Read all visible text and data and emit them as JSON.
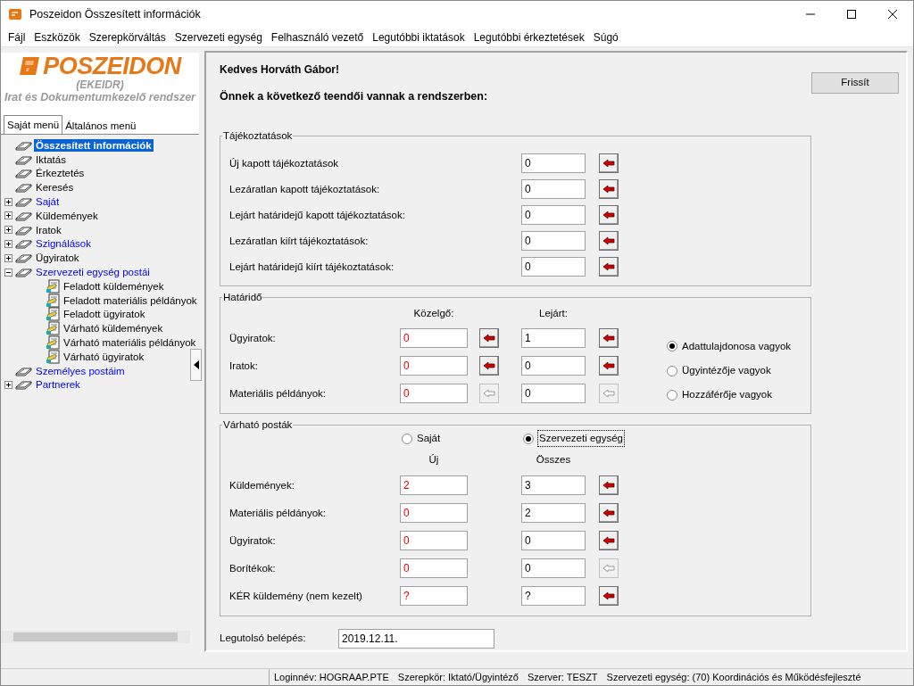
{
  "window": {
    "title": "Poszeidon Összesített információk"
  },
  "menu": [
    "Fájl",
    "Eszközök",
    "Szerepkörváltás",
    "Szervezeti egység",
    "Felhasználó vezető",
    "Legutóbbi iktatások",
    "Legutóbbi érkeztetések",
    "Súgó"
  ],
  "logo": {
    "name": "POSZEIDON",
    "subtitle": "(EKEIDR)",
    "tagline": "Irat és Dokumentumkezelő rendszer"
  },
  "sidebar_tabs": [
    {
      "label": "Saját menü",
      "selected": true
    },
    {
      "label": "Általános menü",
      "selected": false
    }
  ],
  "tree": [
    {
      "label": "Összesített információk",
      "kind": "book",
      "link": false,
      "selected": true
    },
    {
      "label": "Iktatás",
      "kind": "book",
      "link": false,
      "selected": false
    },
    {
      "label": "Érkeztetés",
      "kind": "book",
      "link": false,
      "selected": false
    },
    {
      "label": "Keresés",
      "kind": "book",
      "link": false,
      "selected": false
    },
    {
      "label": "Saját",
      "kind": "book",
      "link": true,
      "selected": false,
      "expanded": false
    },
    {
      "label": "Küldemények",
      "kind": "book",
      "link": false,
      "selected": false,
      "expanded": false
    },
    {
      "label": "Iratok",
      "kind": "book",
      "link": false,
      "selected": false,
      "expanded": false
    },
    {
      "label": "Szignálások",
      "kind": "book",
      "link": true,
      "selected": false,
      "expanded": false
    },
    {
      "label": "Ügyiratok",
      "kind": "book",
      "link": false,
      "selected": false,
      "expanded": false
    },
    {
      "label": "Szervezeti egység postái",
      "kind": "book",
      "link": true,
      "selected": false,
      "expanded": true,
      "children": [
        {
          "label": "Feladott küldemények",
          "kind": "mail",
          "link": false,
          "selected": false
        },
        {
          "label": "Feladott materiális példányok",
          "kind": "mail",
          "link": false,
          "selected": false
        },
        {
          "label": "Feladott ügyiratok",
          "kind": "mail",
          "link": false,
          "selected": false
        },
        {
          "label": "Várható küldemények",
          "kind": "mail",
          "link": false,
          "selected": false
        },
        {
          "label": "Várható materiális példányok",
          "kind": "mail",
          "link": false,
          "selected": false
        },
        {
          "label": "Várható ügyiratok",
          "kind": "mail",
          "link": false,
          "selected": false
        }
      ]
    },
    {
      "label": "Személyes postáim",
      "kind": "book",
      "link": true,
      "selected": false
    },
    {
      "label": "Partnerek",
      "kind": "book",
      "link": true,
      "selected": false,
      "expanded": false
    }
  ],
  "greeting": "Kedves Horváth Gábor!",
  "intro": "Önnek a következő teendői vannak a rendszerben:",
  "refresh_button": "Frissít",
  "notifications": {
    "title": "Tájékoztatások",
    "rows": [
      {
        "label": "Új kapott tájékoztatások",
        "value": "0",
        "disabled": false
      },
      {
        "label": "Lezáratlan kapott tájékoztatások:",
        "value": "0",
        "disabled": false
      },
      {
        "label": "Lejárt határidejű kapott tájékoztatások:",
        "value": "0",
        "disabled": false
      },
      {
        "label": "Lezáratlan kiírt tájékoztatások:",
        "value": "0",
        "disabled": false
      },
      {
        "label": "Lejárt határidejű kiírt tájékoztatások:",
        "value": "0",
        "disabled": false
      }
    ]
  },
  "deadline": {
    "title": "Határidő",
    "columns": [
      "Közelgő:",
      "Lejárt:"
    ],
    "rows": [
      {
        "label": "Ügyiratok:",
        "cells": [
          {
            "value": "0",
            "alert": true,
            "action": {
              "disabled": false
            }
          },
          {
            "value": "1",
            "alert": false,
            "action": {
              "disabled": false
            }
          }
        ]
      },
      {
        "label": "Iratok:",
        "cells": [
          {
            "value": "0",
            "alert": true,
            "action": {
              "disabled": false
            }
          },
          {
            "value": "0",
            "alert": false,
            "action": {
              "disabled": false
            }
          }
        ]
      },
      {
        "label": "Materiális példányok:",
        "cells": [
          {
            "value": "0",
            "alert": true,
            "action": {
              "disabled": true
            }
          },
          {
            "value": "0",
            "alert": false,
            "action": {
              "disabled": true
            }
          }
        ]
      }
    ],
    "options": [
      {
        "label": "Adattulajdonosa vagyok",
        "selected": true
      },
      {
        "label": "Ügyintézője vagyok",
        "selected": false
      },
      {
        "label": "Hozzáférője vagyok",
        "selected": false
      }
    ]
  },
  "expected_mail": {
    "title": "Várható posták",
    "scopes": [
      {
        "label": "Saját",
        "selected": false,
        "focused": false
      },
      {
        "label": "Szervezeti egység",
        "selected": true,
        "focused": true
      }
    ],
    "columns": [
      "Új",
      "Összes"
    ],
    "rows": [
      {
        "label": "Küldemények:",
        "cells": [
          {
            "value": "2",
            "alert": true
          },
          {
            "value": "3",
            "alert": false,
            "action": {
              "disabled": false
            }
          }
        ]
      },
      {
        "label": "Materiális példányok:",
        "cells": [
          {
            "value": "0",
            "alert": true
          },
          {
            "value": "2",
            "alert": false,
            "action": {
              "disabled": false
            }
          }
        ]
      },
      {
        "label": "Ügyiratok:",
        "cells": [
          {
            "value": "0",
            "alert": true
          },
          {
            "value": "0",
            "alert": false,
            "action": {
              "disabled": false
            }
          }
        ]
      },
      {
        "label": "Borítékok:",
        "cells": [
          {
            "value": "0",
            "alert": true
          },
          {
            "value": "0",
            "alert": false,
            "action": {
              "disabled": true
            }
          }
        ]
      },
      {
        "label": "KÉR küldemény (nem kezelt)",
        "cells": [
          {
            "value": "?",
            "alert": true
          },
          {
            "value": "?",
            "alert": false,
            "action": {
              "disabled": false
            }
          }
        ]
      }
    ]
  },
  "last_login": {
    "label": "Legutolsó belépés:",
    "value": "2019.12.11."
  },
  "status_bar": [
    "Loginnév: HOGRAAP.PTE",
    "Szerepkör: Iktató/Ügyintéző",
    "Szerver: TESZT",
    "Szervezeti egység: (70) Koordinációs és Működésfejleszté"
  ]
}
